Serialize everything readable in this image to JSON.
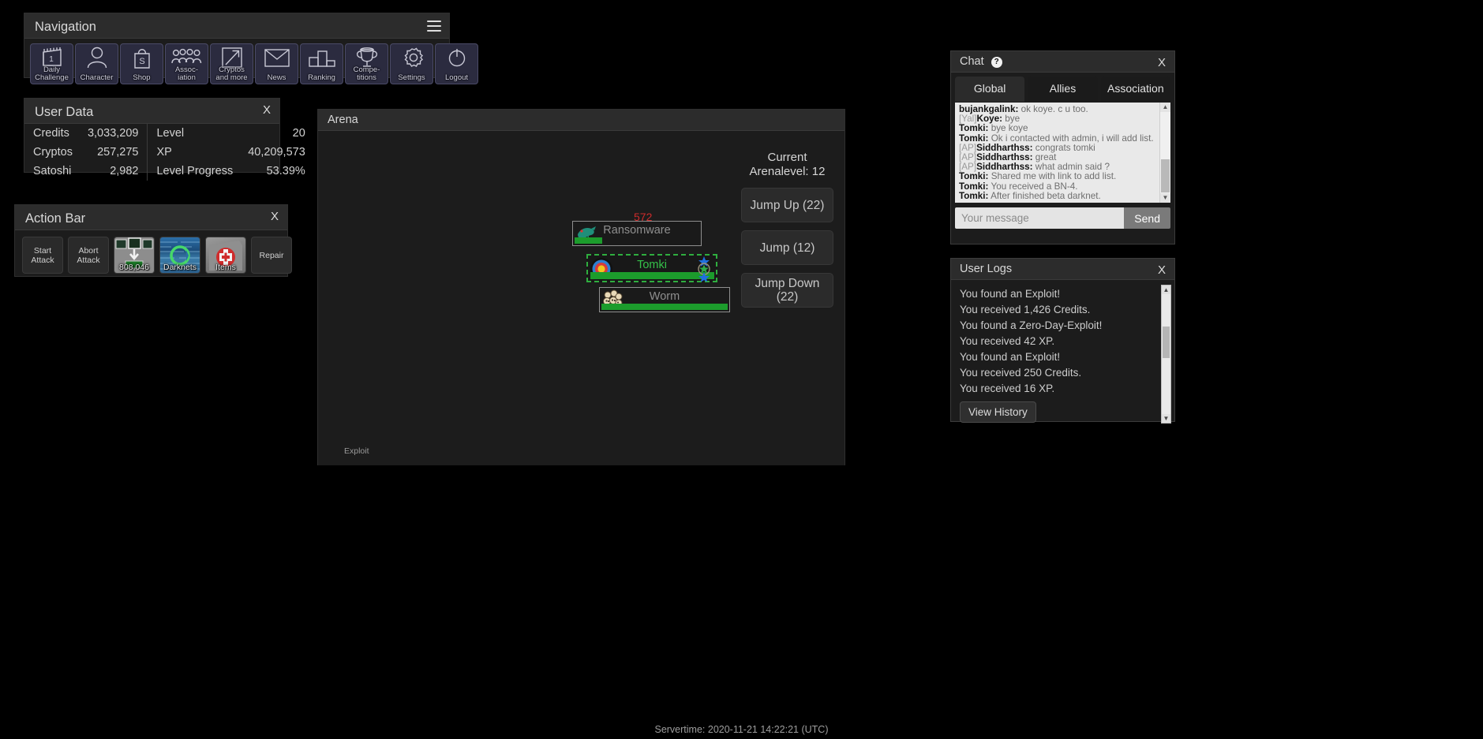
{
  "navigation": {
    "title": "Navigation",
    "menu_icon": "hamburger-icon",
    "items": [
      {
        "label_1": "Daily",
        "label_2": "Challenge",
        "icon": "calendar-icon"
      },
      {
        "label_1": "Character",
        "label_2": "",
        "icon": "person-icon"
      },
      {
        "label_1": "Shop",
        "label_2": "",
        "icon": "shopping-bag-icon"
      },
      {
        "label_1": "Assoc-",
        "label_2": "iation",
        "icon": "people-group-icon"
      },
      {
        "label_1": "Cryptos",
        "label_2": "and more",
        "icon": "trending-arrow-icon"
      },
      {
        "label_1": "News",
        "label_2": "",
        "icon": "envelope-icon"
      },
      {
        "label_1": "Ranking",
        "label_2": "",
        "icon": "podium-icon"
      },
      {
        "label_1": "Compe-",
        "label_2": "titions",
        "icon": "trophy-icon"
      },
      {
        "label_1": "Settings",
        "label_2": "",
        "icon": "gear-icon"
      },
      {
        "label_1": "Logout",
        "label_2": "",
        "icon": "power-icon"
      }
    ]
  },
  "user_data": {
    "title": "User Data",
    "close_label": "X",
    "rows": [
      {
        "k1": "Credits",
        "v1": "3,033,209",
        "k2": "Level",
        "v2": "20"
      },
      {
        "k1": "Cryptos",
        "v1": "257,275",
        "k2": "XP",
        "v2": "40,209,573"
      },
      {
        "k1": "Satoshi",
        "v1": "2,982",
        "k2": "Level Progress",
        "v2": "53.39%"
      }
    ]
  },
  "action_bar": {
    "title": "Action Bar",
    "close_label": "X",
    "buttons": [
      {
        "line1": "Start",
        "line2": "Attack",
        "caption": "",
        "icon": ""
      },
      {
        "line1": "Abort",
        "line2": "Attack",
        "caption": "",
        "icon": ""
      },
      {
        "line1": "",
        "line2": "",
        "caption": "808,046",
        "icon": "hacking-tool-icon"
      },
      {
        "line1": "",
        "line2": "",
        "caption": "Darknets",
        "icon": "darknet-icon"
      },
      {
        "line1": "",
        "line2": "",
        "caption": "Items",
        "icon": "first-aid-kit-icon"
      },
      {
        "line1": "Repair",
        "line2": "",
        "caption": "",
        "icon": ""
      }
    ]
  },
  "arena": {
    "title": "Arena",
    "current_level_line1": "Current",
    "current_level_line2": "Arenalevel: 12",
    "jump_up": "Jump Up (22)",
    "jump": "Jump (12)",
    "jump_down_line1": "Jump Down",
    "jump_down_line2": "(22)",
    "floating_damage": "572",
    "status_text": "Exploit",
    "entities": [
      {
        "name": "Ransomware",
        "hp_percent": 22,
        "self": false,
        "avatar": "ransomware-creature-icon"
      },
      {
        "name": "Tomki",
        "hp_percent": 100,
        "self": true,
        "avatar": "target-icon"
      },
      {
        "name": "Worm",
        "hp_percent": 100,
        "self": false,
        "avatar": "worm-creature-icon"
      }
    ]
  },
  "chat": {
    "title": "Chat",
    "help_icon": "question-mark-icon",
    "close_label": "X",
    "tabs": [
      {
        "label": "Global",
        "active": true
      },
      {
        "label": "Allies",
        "active": false
      },
      {
        "label": "Association",
        "active": false
      }
    ],
    "messages": [
      {
        "tag": "",
        "user": "bujankgalink:",
        "text": "ok koye. c u too."
      },
      {
        "tag": "[Yal]",
        "user": "Koye:",
        "text": "bye"
      },
      {
        "tag": "",
        "user": "Tomki:",
        "text": "bye koye"
      },
      {
        "tag": "",
        "user": "Tomki:",
        "text": "Ok i contacted with admin, i will add list."
      },
      {
        "tag": "[AP]",
        "user": "Siddharthss:",
        "text": "congrats tomki"
      },
      {
        "tag": "[AP]",
        "user": "Siddharthss:",
        "text": "great"
      },
      {
        "tag": "[AP]",
        "user": "Siddharthss:",
        "text": "what admin said ?"
      },
      {
        "tag": "",
        "user": "Tomki:",
        "text": "Shared me with link to add list."
      },
      {
        "tag": "",
        "user": "Tomki:",
        "text": "You received a BN-4."
      },
      {
        "tag": "",
        "user": "Tomki:",
        "text": "After finished beta darknet."
      }
    ],
    "input_placeholder": "Your message",
    "input_value": "",
    "send_label": "Send"
  },
  "user_logs": {
    "title": "User Logs",
    "close_label": "X",
    "lines": [
      "You found an Exploit!",
      "You received 1,426 Credits.",
      "You found a Zero-Day-Exploit!",
      "You received 42 XP.",
      "You found an Exploit!",
      "You received 250 Credits.",
      "You received 16 XP."
    ],
    "view_history_label": "View History"
  },
  "footer": {
    "servertime": "Servertime: 2020-11-21 14:22:21 (UTC)"
  }
}
